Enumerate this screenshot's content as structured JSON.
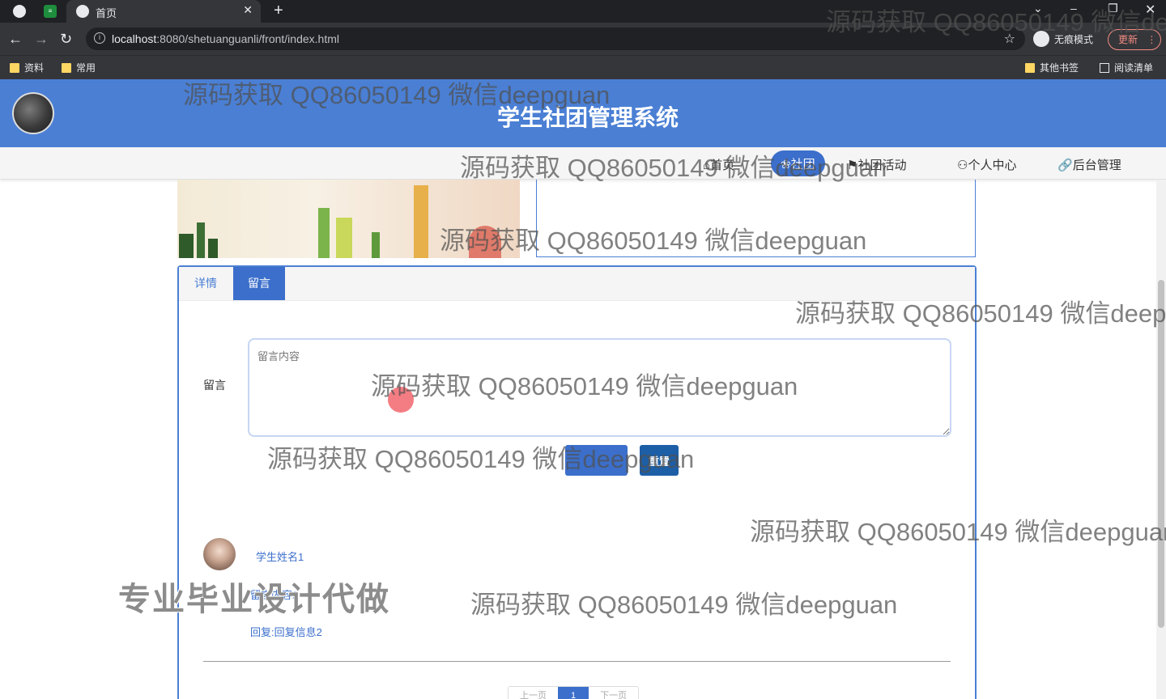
{
  "browser": {
    "tab_title": "首页",
    "url_host": "localhost",
    "url_rest": ":8080/shetuanguanli/front/index.html",
    "incognito_label": "无痕模式",
    "update_label": "更新",
    "bookmarks": [
      "资料",
      "常用"
    ],
    "other_bookmarks": "其他书签",
    "reading_list": "阅读清单"
  },
  "site": {
    "title": "学生社团管理系统",
    "nav": [
      {
        "label": "首页"
      },
      {
        "label": "社团"
      },
      {
        "label": "社团活动"
      },
      {
        "label": "个人中心"
      },
      {
        "label": "后台管理"
      }
    ]
  },
  "tabs": {
    "detail": "详情",
    "message": "留言"
  },
  "form": {
    "label": "留言",
    "placeholder": "留言内容",
    "submit_label": "",
    "reset_label": "重置"
  },
  "comment": {
    "name": "学生姓名1",
    "content": "留言内容2",
    "reply": "回复:回复信息2"
  },
  "pager": {
    "prev": "上一页",
    "current": "1",
    "next": "下一页"
  },
  "watermarks": {
    "qq": "源码获取 QQ86050149 微信deepguan",
    "promo": "专业毕业设计代做"
  }
}
